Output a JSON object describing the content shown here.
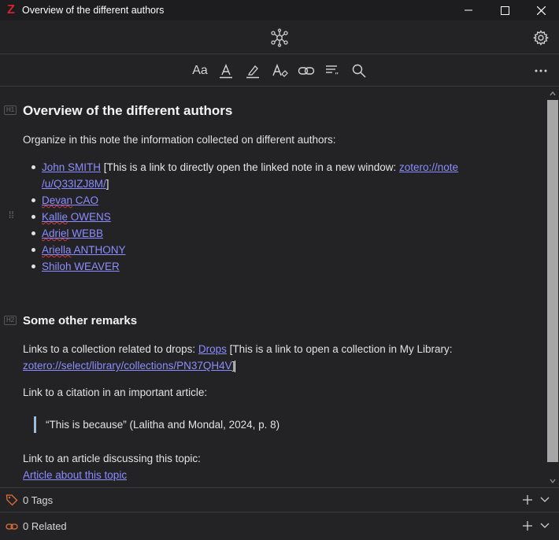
{
  "window": {
    "title": "Overview of the different authors",
    "app_icon": "zotero-icon",
    "app_letter": "Z",
    "brand_color": "#d1242c"
  },
  "toolbar": {
    "items": [
      "text-format-icon",
      "text-color-icon",
      "highlight-icon",
      "clear-format-icon",
      "insert-link-icon",
      "insert-citation-icon",
      "find-replace-icon"
    ],
    "format_label": "Aa"
  },
  "note": {
    "h1_tag": "H1",
    "h1": "Overview of the different authors",
    "intro": "Organize in this note the information collected on different authors:",
    "authors": [
      {
        "name": "John SMITH",
        "note_prefix": " [This is a link to directly open the linked note in a new window: ",
        "url_line1": "zotero://note",
        "url_line2": "/u/Q33IZJ8M/",
        "note_suffix": "]"
      },
      {
        "first": "Devan",
        "last": " CAO"
      },
      {
        "first": "Kallie",
        "last": " OWENS"
      },
      {
        "first": "Adriel",
        "last": " WEBB"
      },
      {
        "first": "Ariella",
        "last": " ANTHONY"
      },
      {
        "first": "Shiloh",
        "last": " WEAVER"
      }
    ],
    "h2_tag": "H2",
    "h2": "Some other remarks",
    "collection_prefix": "Links to a collection related to drops: ",
    "collection_link": "Drops",
    "collection_note": " [This is a link to open a collection in My Library:",
    "collection_url": "zotero://select/library/collections/PN37QH4V",
    "collection_close": "]",
    "citation_intro": "Link to a citation in an important article:",
    "quote": "“This is because” (Lalitha and Mondal, 2024, p. 8)",
    "article_intro": "Link to an article discussing this topic:",
    "article_link": "Article about this topic"
  },
  "footer": {
    "tags_label": "0 Tags",
    "related_label": "0 Related"
  },
  "colors": {
    "background": "#232325",
    "link": "#8c8cff",
    "accent_orange": "#e0703a"
  }
}
